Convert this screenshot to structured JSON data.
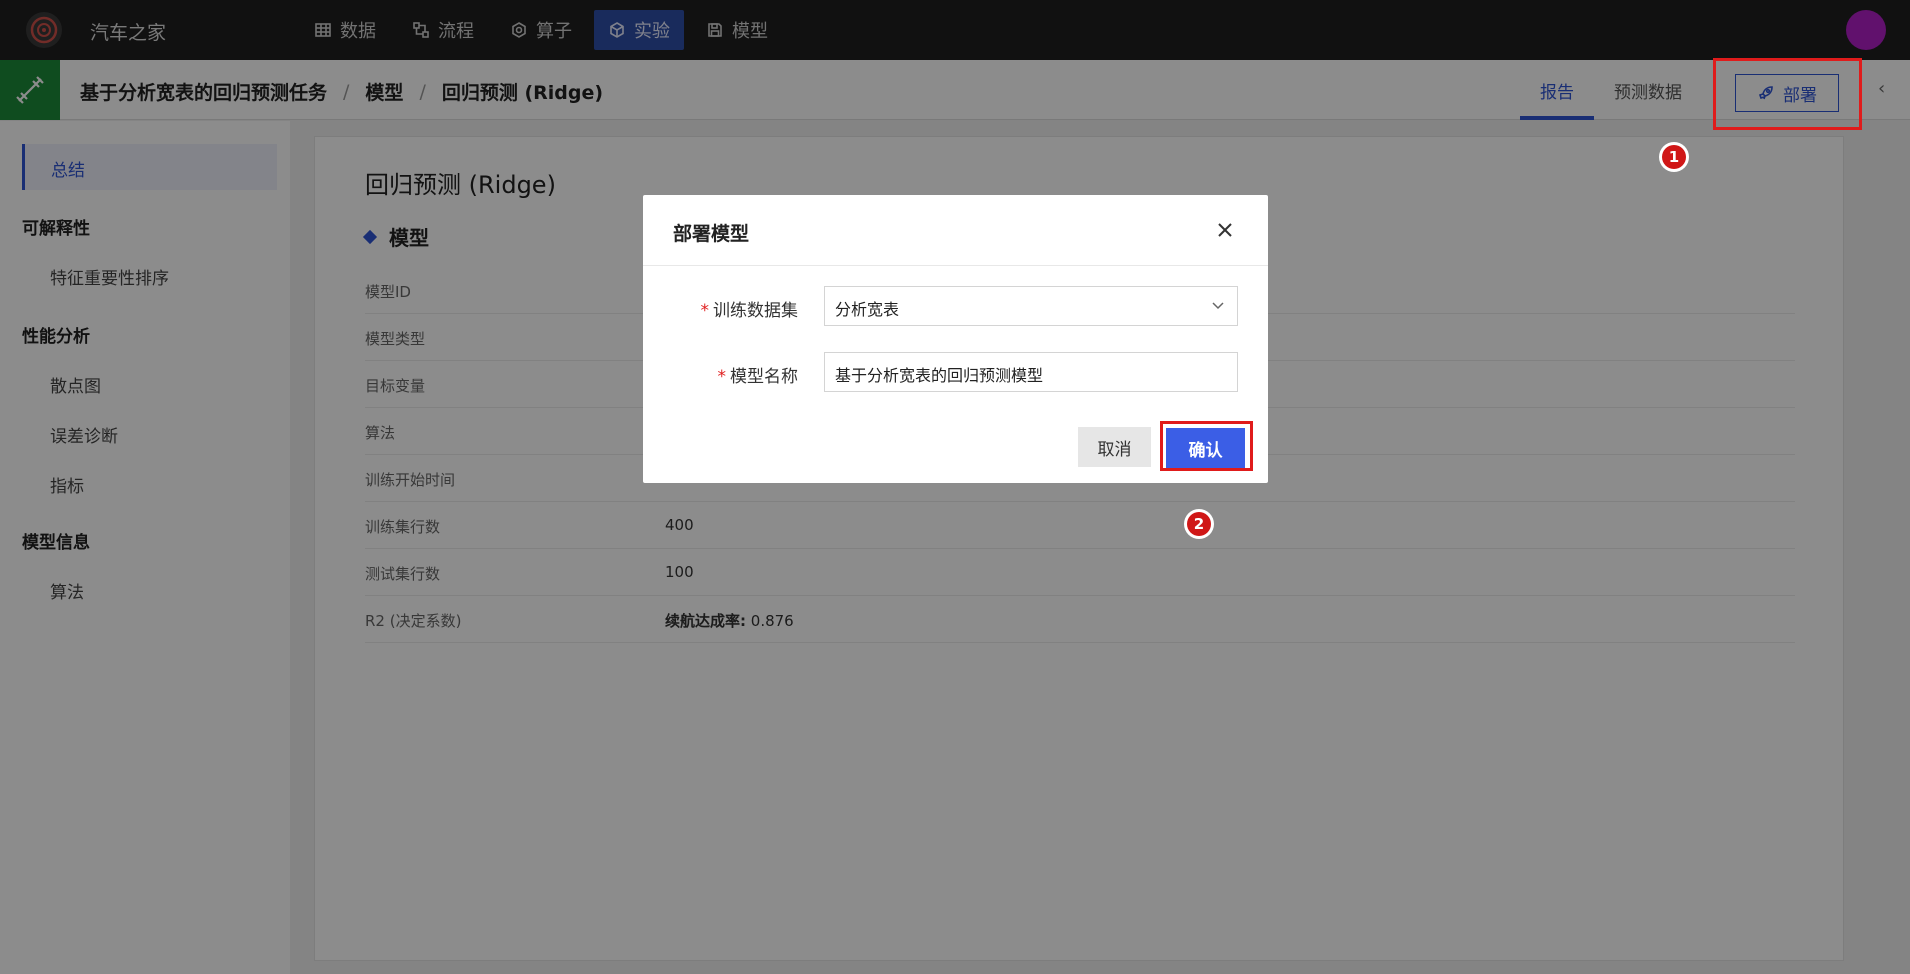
{
  "app": {
    "title": "汽车之家"
  },
  "nav": {
    "items": [
      {
        "label": "数据",
        "icon": "table-icon"
      },
      {
        "label": "流程",
        "icon": "flow-icon"
      },
      {
        "label": "算子",
        "icon": "operator-icon"
      },
      {
        "label": "实验",
        "icon": "cube-icon",
        "active": true
      },
      {
        "label": "模型",
        "icon": "save-icon"
      }
    ]
  },
  "breadcrumb": {
    "task": "基于分析宽表的回归预测任务",
    "section": "模型",
    "current": "回归预测 (Ridge)",
    "sep": "/"
  },
  "header_tabs": [
    {
      "label": "报告",
      "active": true
    },
    {
      "label": "预测数据"
    }
  ],
  "deploy_button": {
    "label": "部署"
  },
  "sidebar": {
    "active": "总结",
    "groups": [
      {
        "title": "可解释性",
        "items": [
          "特征重要性排序"
        ]
      },
      {
        "title": "性能分析",
        "items": [
          "散点图",
          "误差诊断",
          "指标"
        ]
      },
      {
        "title": "模型信息",
        "items": [
          "算法"
        ]
      }
    ]
  },
  "main": {
    "title": "回归预测 (Ridge)",
    "section": "模型",
    "rows": [
      {
        "key": "模型ID",
        "value": ""
      },
      {
        "key": "模型类型",
        "value": ""
      },
      {
        "key": "目标变量",
        "value": ""
      },
      {
        "key": "算法",
        "value": ""
      },
      {
        "key": "训练开始时间",
        "value": ""
      },
      {
        "key": "训练集行数",
        "value": "400"
      },
      {
        "key": "测试集行数",
        "value": "100"
      },
      {
        "key": "R2 (决定系数)",
        "value_label": "续航达成率:",
        "value": "0.876"
      }
    ]
  },
  "modal": {
    "title": "部署模型",
    "fields": [
      {
        "label": "训练数据集",
        "value": "分析宽表",
        "type": "select"
      },
      {
        "label": "模型名称",
        "value": "基于分析宽表的回归预测模型",
        "type": "input"
      }
    ],
    "cancel": "取消",
    "confirm": "确认"
  },
  "annotations": {
    "marker1": "1",
    "marker2": "2",
    "color": "#e01b1b"
  }
}
